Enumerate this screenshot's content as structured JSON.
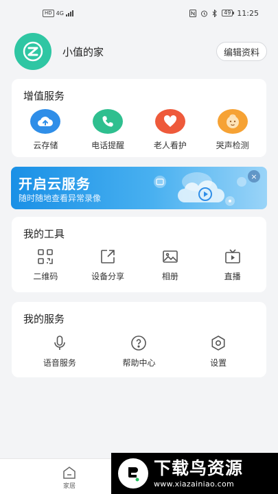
{
  "status_bar": {
    "left_tags": [
      "HD",
      "4G"
    ],
    "time": "11:25",
    "battery": "49"
  },
  "profile": {
    "name": "小值的家",
    "edit_label": "编辑资料"
  },
  "value_services": {
    "title": "增值服务",
    "items": [
      {
        "label": "云存储",
        "icon": "cloud-upload-icon",
        "color": "#2f8ee8"
      },
      {
        "label": "电话提醒",
        "icon": "phone-icon",
        "color": "#2fbf8f"
      },
      {
        "label": "老人看护",
        "icon": "heart-icon",
        "color": "#ee5a3b"
      },
      {
        "label": "哭声检测",
        "icon": "baby-face-icon",
        "color": "#f6a234"
      }
    ]
  },
  "banner": {
    "title": "开启云服务",
    "subtitle": "随时随地查看异常录像",
    "close": "×"
  },
  "my_tools": {
    "title": "我的工具",
    "items": [
      {
        "label": "二维码",
        "icon": "qr-code-icon"
      },
      {
        "label": "设备分享",
        "icon": "share-icon"
      },
      {
        "label": "相册",
        "icon": "album-icon"
      },
      {
        "label": "直播",
        "icon": "live-tv-icon"
      }
    ]
  },
  "my_services": {
    "title": "我的服务",
    "items": [
      {
        "label": "语音服务",
        "icon": "microphone-icon"
      },
      {
        "label": "帮助中心",
        "icon": "help-icon"
      },
      {
        "label": "设置",
        "icon": "settings-icon"
      }
    ]
  },
  "tabbar": {
    "home_label": "家居"
  },
  "watermark": {
    "title": "下载鸟资源",
    "url": "www.xiazainiao.com"
  }
}
